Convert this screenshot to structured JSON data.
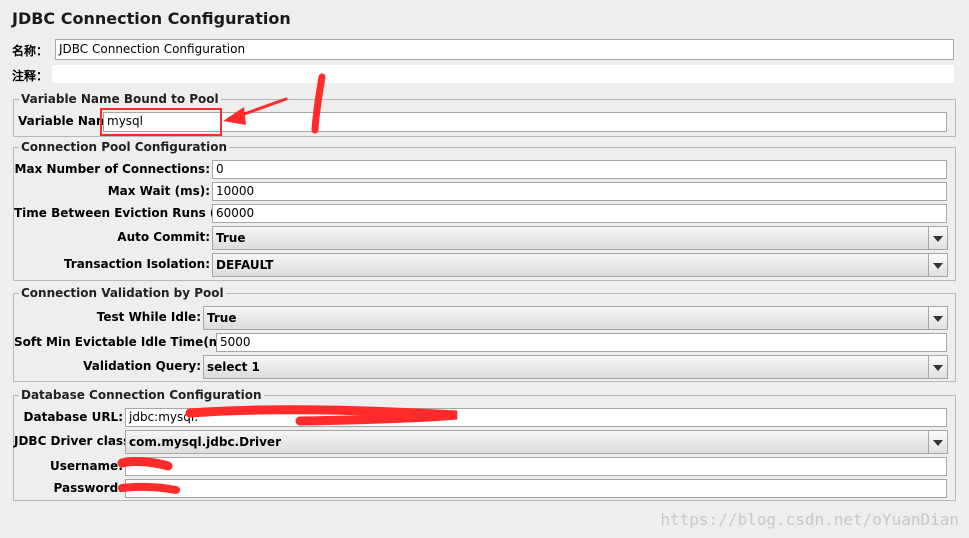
{
  "title": "JDBC Connection Configuration",
  "name_label": "名称：",
  "name_value": "JDBC Connection Configuration",
  "comment_label": "注释：",
  "comment_value": "",
  "variable_panel": {
    "legend": "Variable Name Bound to Pool",
    "label": "Variable Name",
    "value": "mysql"
  },
  "pool_panel": {
    "legend": "Connection Pool Configuration",
    "max_conn_label": "Max Number of Connections:",
    "max_conn_value": "0",
    "max_wait_label": "Max Wait (ms):",
    "max_wait_value": "10000",
    "eviction_label": "Time Between Eviction Runs (ms):",
    "eviction_value": "60000",
    "auto_commit_label": "Auto Commit:",
    "auto_commit_value": "True",
    "isolation_label": "Transaction Isolation:",
    "isolation_value": "DEFAULT"
  },
  "validation_panel": {
    "legend": "Connection Validation by Pool",
    "test_idle_label": "Test While Idle:",
    "test_idle_value": "True",
    "soft_min_label": "Soft Min Evictable Idle Time(ms):",
    "soft_min_value": "5000",
    "query_label": "Validation Query:",
    "query_value": "select 1"
  },
  "db_panel": {
    "legend": "Database Connection Configuration",
    "url_label": "Database URL:",
    "url_value": "jdbc:mysql:",
    "driver_label": "JDBC Driver class:",
    "driver_value": "com.mysql.jdbc.Driver",
    "username_label": "Username:",
    "username_value": "",
    "password_label": "Password:",
    "password_value": ""
  },
  "watermark": "https://blog.csdn.net/oYuanDian",
  "colors": {
    "annotation_red": "#ff2a2a",
    "background": "#eeeeee"
  }
}
